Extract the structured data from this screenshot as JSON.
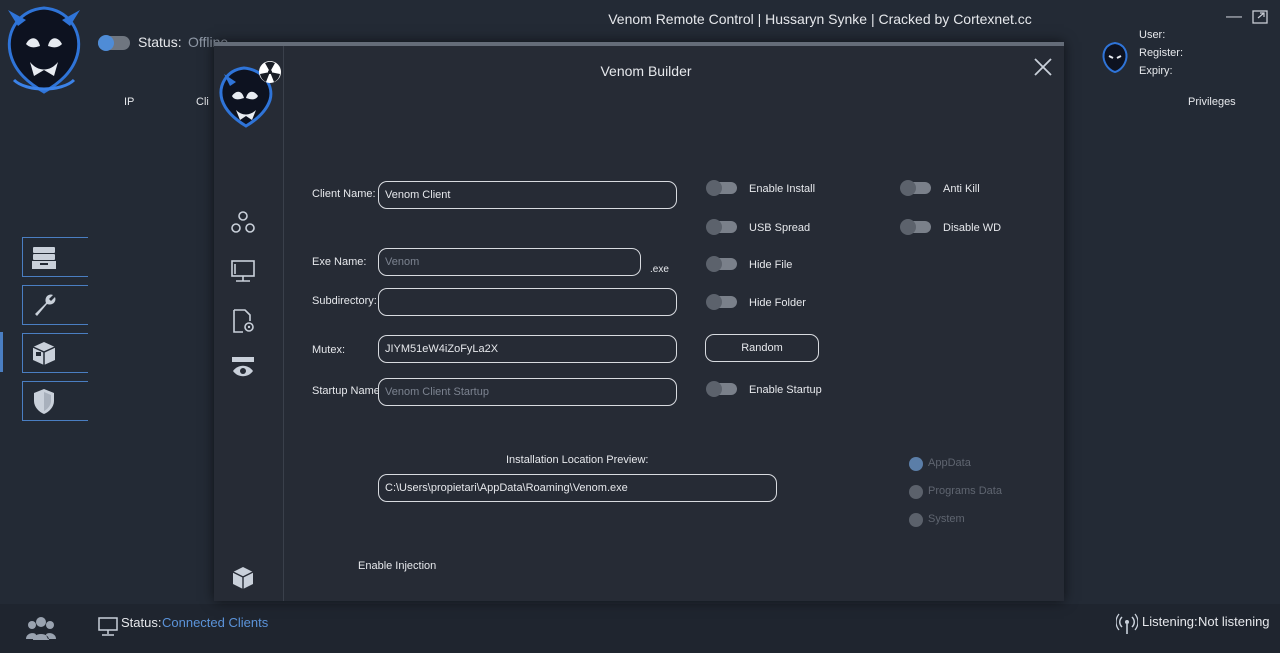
{
  "window": {
    "title": "Venom Remote Control | Hussaryn  Synke | Cracked by Cortexnet.cc",
    "status_label": "Status:",
    "status_value": "Offline",
    "user_labels": [
      "User:",
      "Register:",
      "Expiry:"
    ],
    "columns": [
      "IP",
      "Cli",
      "Privileges"
    ],
    "sidebar_icons": [
      "inbox-icon",
      "wrench-icon",
      "package-icon",
      "shield-icon"
    ],
    "bottom": {
      "status_label": "Status:",
      "status_value": "Connected Clients",
      "listening_label": "Listening:",
      "listening_value": "Not listening"
    }
  },
  "builder": {
    "title": "Venom Builder",
    "sidebar_icons": [
      "network-icon",
      "monitor-icon",
      "file-settings-icon",
      "eye-icon",
      "box-icon"
    ],
    "client_name": {
      "label": "Client Name:",
      "value": "Venom Client"
    },
    "exe_name": {
      "label": "Exe Name:",
      "placeholder": "Venom",
      "suffix": ".exe"
    },
    "subdirectory": {
      "label": "Subdirectory:",
      "value": ""
    },
    "mutex": {
      "label": "Mutex:",
      "value": "JIYM51eW4iZoFyLa2X"
    },
    "startup_name": {
      "label": "Startup Name:",
      "placeholder": "Venom Client Startup"
    },
    "random_button": "Random",
    "toggles": {
      "enable_install": "Enable Install",
      "usb_spread": "USB Spread",
      "hide_file": "Hide File",
      "hide_folder": "Hide Folder",
      "enable_startup": "Enable Startup",
      "anti_kill": "Anti Kill",
      "disable_wd": "Disable WD"
    },
    "preview_label": "Installation Location Preview:",
    "preview_value": "C:\\Users\\propietari\\AppData\\Roaming\\Venom.exe",
    "install_locations": [
      "AppData",
      "Programs Data",
      "System"
    ],
    "selected_location": "AppData",
    "enable_injection": "Enable Injection"
  },
  "colors": {
    "accent": "#4a7ec2",
    "link": "#5b93d9",
    "background": "#232a35"
  }
}
